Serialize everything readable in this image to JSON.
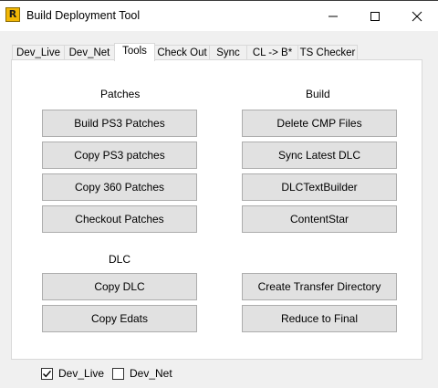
{
  "window": {
    "title": "Build Deployment Tool",
    "icon_letter": "R"
  },
  "tabs": [
    "Dev_Live",
    "Dev_Net",
    "Tools",
    "Check Out",
    "Sync",
    "CL -> B*",
    "TS Checker"
  ],
  "active_tab": "Tools",
  "patches": {
    "label": "Patches",
    "buttons": [
      "Build PS3 Patches",
      "Copy PS3 patches",
      "Copy 360 Patches",
      "Checkout Patches"
    ]
  },
  "build": {
    "label": "Build",
    "buttons": [
      "Delete CMP Files",
      "Sync Latest DLC",
      "DLCTextBuilder",
      "ContentStar"
    ]
  },
  "dlc": {
    "label": "DLC",
    "buttons": [
      "Copy DLC",
      "Copy Edats"
    ]
  },
  "other": {
    "buttons": [
      "Create Transfer Directory",
      "Reduce to Final"
    ]
  },
  "checkboxes": [
    {
      "label": "Dev_Live",
      "checked": true
    },
    {
      "label": "Dev_Net",
      "checked": false
    }
  ]
}
